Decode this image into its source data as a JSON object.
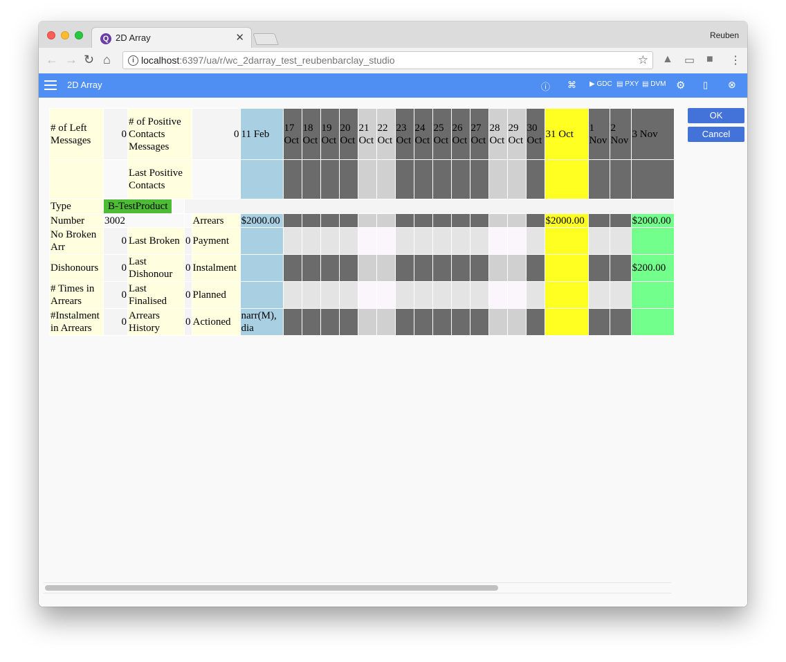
{
  "browser": {
    "tab_title": "2D Array",
    "favicon_glyph": "Q",
    "profile": "Reuben",
    "url_host": "localhost",
    "url_rest": ":6397/ua/r/wc_2darray_test_reubenbarclay_studio"
  },
  "appbar": {
    "title": "2D Array",
    "btn_gdc": "GDC",
    "btn_pxy": "PXY",
    "btn_dvm": "DVM"
  },
  "colors": {
    "appbar": "#4f8ef2",
    "label_bg": "#ffffe0",
    "date_blue": "#a9cfe3",
    "date_dark": "#6b6b6b",
    "date_light": "#d0d0d0",
    "today_yellow": "#ffff22",
    "future_green": "#72ff8c",
    "product_badge": "#4dbb35",
    "button": "#4373d9"
  },
  "grid": {
    "row1": {
      "label_left": "# of Left Messages",
      "value_left": "0",
      "label_mid": "# of Positive Contacts Messages",
      "value_mid": "0"
    },
    "row2": {
      "label_mid": "Last Positive Contacts"
    },
    "row3": {
      "label_left": "Type",
      "product": "B-TestProduct"
    },
    "row4": {
      "label_left": "Number",
      "value_left": "3002",
      "label_right": "Arrears"
    },
    "row5": {
      "label_left": "No Broken Arr",
      "value_left": "0",
      "label_mid": "Last Broken",
      "value_mid": "0",
      "label_right": "Payment"
    },
    "row6": {
      "label_left": "Dishonours",
      "value_left": "0",
      "label_mid": "Last Dishonour",
      "value_mid": "0",
      "label_right": "Instalment"
    },
    "row7": {
      "label_left": "# Times in Arrears",
      "value_left": "0",
      "label_mid": "Last Finalised",
      "value_mid": "0",
      "label_right": "Planned"
    },
    "row8": {
      "label_left": "#Instalment in Arrears",
      "value_left": "0",
      "label_mid": "Arrears History",
      "value_mid": "0",
      "label_right": "Actioned"
    },
    "dates": [
      "11 Feb",
      "17 Oct",
      "18 Oct",
      "19 Oct",
      "20 Oct",
      "21 Oct",
      "22 Oct",
      "23 Oct",
      "24 Oct",
      "25 Oct",
      "26 Oct",
      "27 Oct",
      "28 Oct",
      "29 Oct",
      "30 Oct",
      "31 Oct",
      "1 Nov",
      "2 Nov",
      "3 Nov"
    ],
    "arrears_feb": "$2000.00",
    "arrears_today": "$2000.00",
    "arrears_future": "$2000.00",
    "instalment_future": "$200.00",
    "actioned_feb": "narr(M), dia"
  },
  "actions": {
    "ok": "OK",
    "cancel": "Cancel"
  }
}
